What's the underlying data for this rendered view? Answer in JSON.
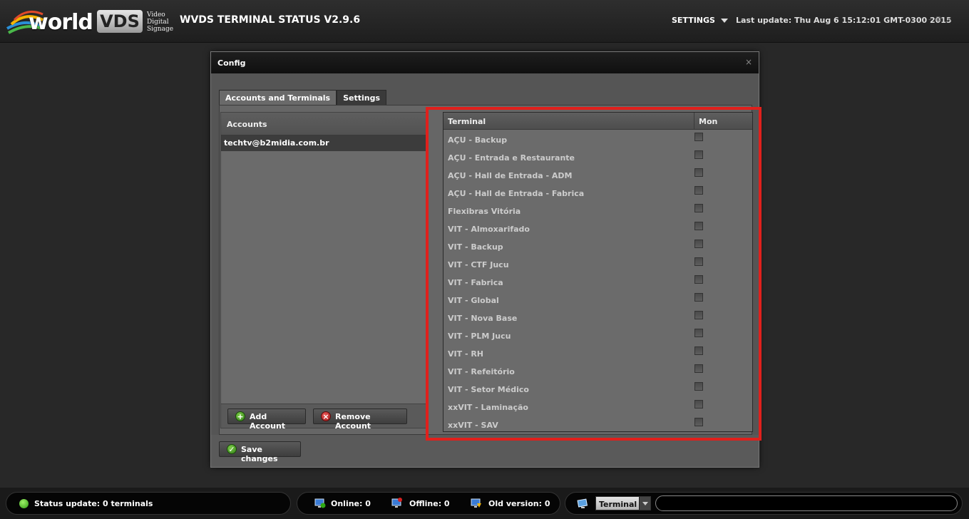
{
  "header": {
    "logo_world": "world",
    "logo_vds": "VDS",
    "logo_sub": [
      "Video",
      "Digital",
      "Signage"
    ],
    "title": "WVDS TERMINAL STATUS V2.9.6",
    "settings_label": "SETTINGS",
    "last_update": "Last update: Thu Aug 6 15:12:01 GMT-0300 2015"
  },
  "dialog": {
    "title": "Config",
    "tabs": [
      "Accounts and Terminals",
      "Settings"
    ],
    "accounts_header": "Accounts",
    "accounts": [
      "techtv@b2midia.com.br"
    ],
    "add_account_label": "Add Account",
    "remove_account_label": "Remove Account",
    "terminal_col": "Terminal",
    "mon_col": "Mon",
    "terminals": [
      "AÇU - Backup",
      "AÇU - Entrada e Restaurante",
      "AÇU - Hall de Entrada - ADM",
      "AÇU - Hall de Entrada - Fabrica",
      "Flexibras Vitória",
      "VIT - Almoxarifado",
      "VIT - Backup",
      "VIT - CTF Jucu",
      "VIT - Fabrica",
      "VIT - Global",
      "VIT - Nova Base",
      "VIT - PLM Jucu",
      "VIT - RH",
      "VIT - Refeitório",
      "VIT - Setor Médico",
      "xxVIT - Laminação",
      "xxVIT - SAV"
    ],
    "save_label": "Save changes"
  },
  "status": {
    "status_update": "Status update: 0 terminals",
    "online": "Online: 0",
    "offline": "Offline: 0",
    "old_version": "Old version: 0",
    "filter_type": "Terminal",
    "filter_value": ""
  },
  "colors": {
    "highlight": "#e0201c",
    "online_dot": "#2f9a10"
  }
}
